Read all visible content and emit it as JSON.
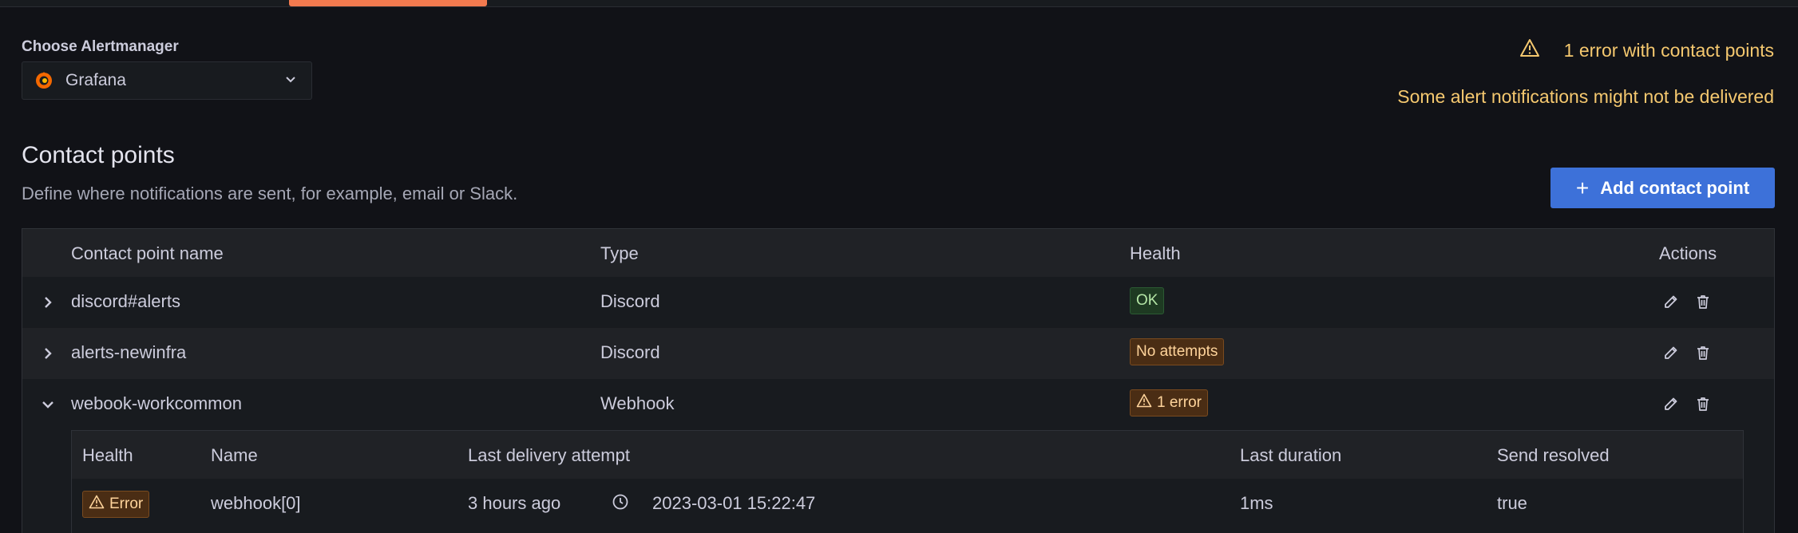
{
  "alertmanager": {
    "label": "Choose Alertmanager",
    "selected": "Grafana"
  },
  "warning": {
    "title": "1 error with contact points",
    "subtitle": "Some alert notifications might not be delivered",
    "color": "#f5c86f"
  },
  "section": {
    "title": "Contact points",
    "description": "Define where notifications are sent, for example, email or Slack."
  },
  "add_button": {
    "label": "Add contact point",
    "color": "#3d71d9"
  },
  "table": {
    "columns": [
      "Contact point name",
      "Type",
      "Health",
      "Actions"
    ],
    "rows": [
      {
        "name": "discord#alerts",
        "type": "Discord",
        "health": "OK",
        "expanded": false
      },
      {
        "name": "alerts-newinfra",
        "type": "Discord",
        "health": "No attempts",
        "expanded": false
      },
      {
        "name": "webook-workcommon",
        "type": "Webhook",
        "health": "1 error",
        "expanded": true
      }
    ]
  },
  "subtable": {
    "columns": [
      "Health",
      "Name",
      "Last delivery attempt",
      "Last duration",
      "Send resolved"
    ],
    "rows": [
      {
        "health": "Error",
        "name": "webhook[0]",
        "last_attempt_relative": "3 hours ago",
        "last_attempt_time": "2023-03-01 15:22:47",
        "duration": "1ms",
        "send_resolved": "true"
      }
    ]
  },
  "icons": [
    "grafana-logo-icon",
    "chevron-down-icon",
    "warning-icon",
    "plus-icon",
    "chevron-right-icon",
    "edit-icon",
    "trash-icon",
    "clock-icon"
  ]
}
